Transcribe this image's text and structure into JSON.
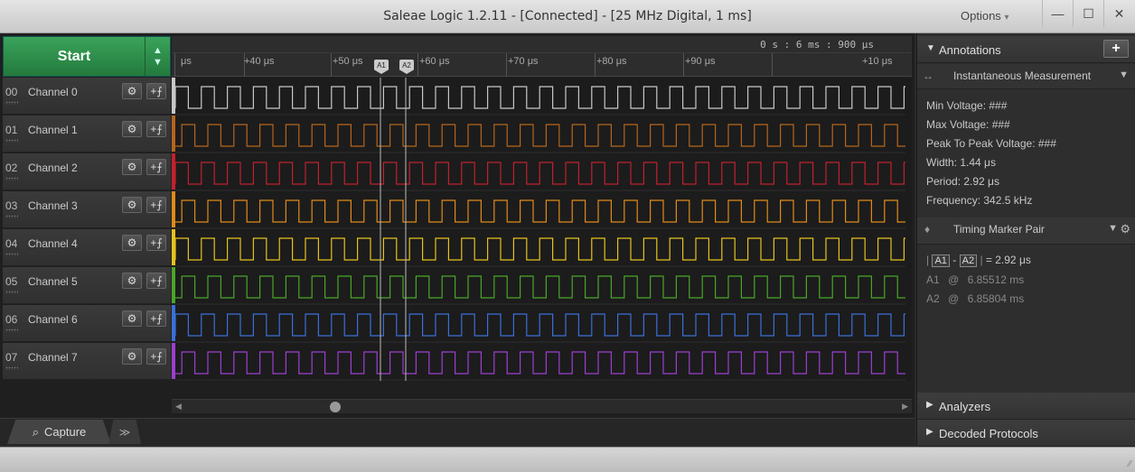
{
  "window": {
    "title": "Saleae Logic 1.2.11 - [Connected] - [25 MHz Digital, 1 ms]",
    "options_label": "Options",
    "options_arrow": "▾",
    "minimize": "—",
    "maximize": "☐",
    "close": "✕"
  },
  "toolbar": {
    "start_label": "Start",
    "up_arrow": "▲",
    "down_arrow": "▼"
  },
  "ruler": {
    "absolute_time": "0 s : 6 ms : 900 μs",
    "ticks": [
      "μs",
      "+40 μs",
      "+50 μs",
      "+60 μs",
      "+70 μs",
      "+80 μs",
      "+90 μs",
      "+10 μs"
    ],
    "markers": [
      "A1",
      "A2"
    ]
  },
  "channels": [
    {
      "num": "00",
      "name": "Channel 0",
      "color": "#c8c8c8",
      "half_period": 14.4
    },
    {
      "num": "01",
      "name": "Channel 1",
      "color": "#b5651d",
      "half_period": 14.4
    },
    {
      "num": "02",
      "name": "Channel 2",
      "color": "#c0212e",
      "half_period": 14.4
    },
    {
      "num": "03",
      "name": "Channel 3",
      "color": "#e08a1a",
      "half_period": 14.4
    },
    {
      "num": "04",
      "name": "Channel 4",
      "color": "#e6c21c",
      "half_period": 14.4
    },
    {
      "num": "05",
      "name": "Channel 5",
      "color": "#4aa528",
      "half_period": 14.4
    },
    {
      "num": "06",
      "name": "Channel 6",
      "color": "#3b6fd8",
      "half_period": 14.4
    },
    {
      "num": "07",
      "name": "Channel 7",
      "color": "#9b3fd0",
      "half_period": 14.4
    }
  ],
  "icons": {
    "gear": "⚙",
    "trigger": "+⨍"
  },
  "tabs": {
    "capture": "Capture",
    "more": "≫",
    "capture_icon": "⌕"
  },
  "annotations": {
    "header": "Annotations",
    "add": "+",
    "measurement_lead": "↔",
    "measurement_title": "Instantaneous Measurement",
    "measurement_dropdown": "▼",
    "lines": [
      "Min Voltage: ###",
      "Max Voltage: ###",
      "Peak To Peak Voltage: ###",
      "Width: 1.44 μs",
      "Period: 2.92 μs",
      "Frequency: 342.5 kHz"
    ],
    "marker_pair_lead": "♦",
    "marker_pair_title": "Timing Marker Pair",
    "marker_pair_dropdown": "▼",
    "marker_pair_gear": "⚙",
    "pair_a1": "A1",
    "pair_dash": "-",
    "pair_a2": "A2",
    "pair_value": "= 2.92 μs",
    "a1_label": "A1",
    "a1_at": "@",
    "a1_time": "6.85512 ms",
    "a2_label": "A2",
    "a2_at": "@",
    "a2_time": "6.85804 ms"
  },
  "analyzers": {
    "label": "Analyzers",
    "arrow": "▶"
  },
  "decoded": {
    "label": "Decoded Protocols",
    "arrow": "▶"
  },
  "statusbar": {
    "grip": "⁄⁄"
  }
}
